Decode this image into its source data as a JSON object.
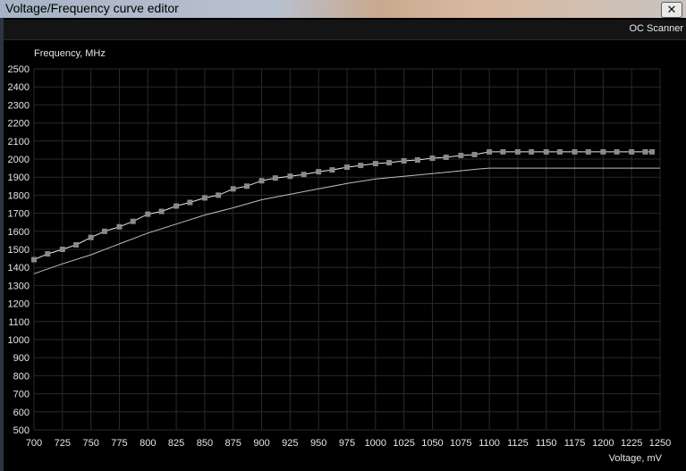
{
  "window": {
    "title": "Voltage/Frequency curve editor",
    "close_glyph": "✕"
  },
  "toolbar": {
    "oc_scanner_label": "OC Scanner"
  },
  "chart_data": {
    "type": "line",
    "ylabel": "Frequency, MHz",
    "xlabel": "Voltage, mV",
    "xlim": [
      700,
      1250
    ],
    "ylim": [
      500,
      2500
    ],
    "x_ticks": [
      700,
      725,
      750,
      775,
      800,
      825,
      850,
      875,
      900,
      925,
      950,
      975,
      1000,
      1025,
      1050,
      1075,
      1100,
      1125,
      1150,
      1175,
      1200,
      1225,
      1250
    ],
    "y_ticks": [
      500,
      600,
      700,
      800,
      900,
      1000,
      1100,
      1200,
      1300,
      1400,
      1500,
      1600,
      1700,
      1800,
      1900,
      2000,
      2100,
      2200,
      2300,
      2400,
      2500
    ],
    "grid": true,
    "series": [
      {
        "color": "#e8e8e8",
        "markers": true,
        "marker_color": "#8a8a8a",
        "x": [
          700,
          712,
          725,
          737,
          750,
          762,
          775,
          787,
          800,
          812,
          825,
          837,
          850,
          862,
          875,
          887,
          900,
          912,
          925,
          937,
          950,
          962,
          975,
          987,
          1000,
          1012,
          1025,
          1037,
          1050,
          1062,
          1075,
          1087,
          1100,
          1112,
          1125,
          1137,
          1150,
          1162,
          1175,
          1187,
          1200,
          1212,
          1225,
          1237,
          1243
        ],
        "y": [
          1443,
          1475,
          1500,
          1525,
          1566,
          1600,
          1625,
          1655,
          1695,
          1710,
          1740,
          1760,
          1785,
          1800,
          1835,
          1850,
          1880,
          1895,
          1905,
          1915,
          1930,
          1940,
          1955,
          1965,
          1975,
          1980,
          1990,
          1995,
          2005,
          2010,
          2020,
          2025,
          2040,
          2040,
          2040,
          2040,
          2040,
          2040,
          2040,
          2040,
          2040,
          2040,
          2040,
          2040,
          2040
        ]
      },
      {
        "color": "#bdbdbd",
        "markers": false,
        "x": [
          700,
          725,
          750,
          775,
          800,
          825,
          850,
          875,
          900,
          925,
          950,
          975,
          1000,
          1025,
          1050,
          1075,
          1090,
          1100,
          1250
        ],
        "y": [
          1365,
          1420,
          1470,
          1530,
          1590,
          1640,
          1690,
          1730,
          1775,
          1805,
          1835,
          1865,
          1890,
          1905,
          1920,
          1935,
          1945,
          1950,
          1950
        ]
      }
    ]
  }
}
